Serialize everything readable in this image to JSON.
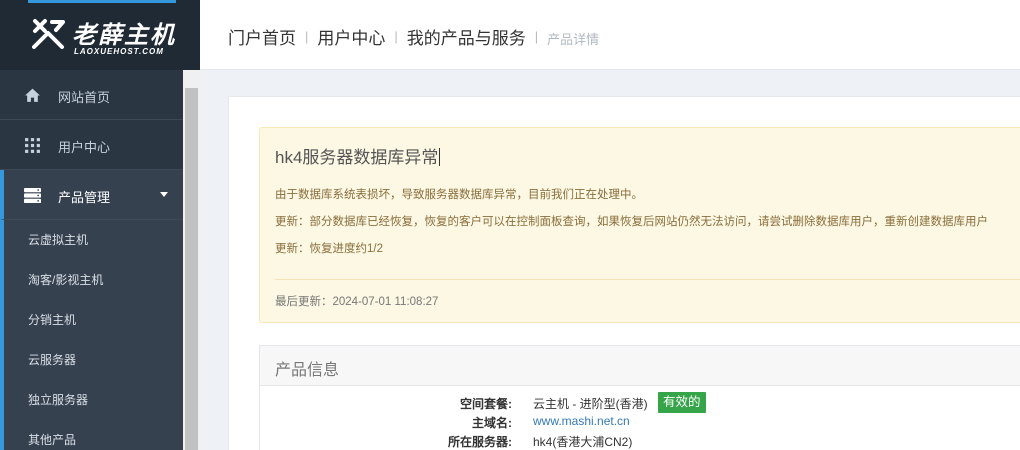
{
  "brand": {
    "name": "老薛主机",
    "domain": "LAOXUEHOST.COM",
    "accent": "#3598dc"
  },
  "header": {
    "breadcrumb": [
      {
        "label": "门户首页"
      },
      {
        "label": "用户中心"
      },
      {
        "label": "我的产品与服务"
      },
      {
        "label": "产品详情"
      }
    ]
  },
  "sidebar": {
    "items": [
      {
        "label": "网站首页",
        "icon": "home-icon"
      },
      {
        "label": "用户中心",
        "icon": "grid-icon"
      },
      {
        "label": "产品管理",
        "icon": "server-icon",
        "expanded": true
      }
    ],
    "submenu": [
      {
        "label": "云虚拟主机"
      },
      {
        "label": "淘客/影视主机"
      },
      {
        "label": "分销主机"
      },
      {
        "label": "云服务器"
      },
      {
        "label": "独立服务器"
      },
      {
        "label": "其他产品"
      }
    ]
  },
  "notice": {
    "title": "hk4服务器数据库异常",
    "lines": [
      "由于数据库系统表损坏，导致服务器数据库异常，目前我们正在处理中。",
      "更新：部分数据库已经恢复，恢复的客户可以在控制面板查询，如果恢复后网站仍然无法访问，请尝试删除数据库用户，重新创建数据库用户",
      "更新：恢复进度约1/2"
    ],
    "last_updated": "最后更新：2024-07-01 11:08:27",
    "background": "#fcf8e3"
  },
  "product": {
    "panel_title": "产品信息",
    "package_label": "空间套餐:",
    "package_value": "云主机 - 进阶型(香港)",
    "status_badge": "有效的",
    "status_color": "#36a54a",
    "domain_label": "主域名:",
    "domain_value": "www.mashi.net.cn",
    "server_label": "所在服务器:",
    "server_value": "hk4(香港大浦CN2)"
  }
}
